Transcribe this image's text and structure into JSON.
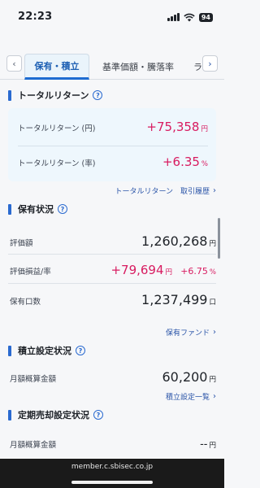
{
  "status": {
    "time": "22:23",
    "battery": "94"
  },
  "tabs": {
    "active": "保有・積立",
    "second": "基準価額・騰落率",
    "third": "ラ"
  },
  "total_return": {
    "title": "トータルリターン",
    "yen_label": "トータルリターン (円)",
    "yen_value": "+75,358",
    "yen_unit": "円",
    "rate_label": "トータルリターン (率)",
    "rate_value": "+6.35",
    "rate_unit": "%",
    "link_label": "トータルリターン　取引履歴"
  },
  "holdings": {
    "title": "保有状況",
    "valuation_label": "評価額",
    "valuation_value": "1,260,268",
    "valuation_unit": "円",
    "gain_label": "評価損益/率",
    "gain_value": "+79,694",
    "gain_unit": "円",
    "gain_rate": "+6.75",
    "gain_rate_unit": "%",
    "units_label": "保有口数",
    "units_value": "1,237,499",
    "units_unit": "口",
    "link_label": "保有ファンド"
  },
  "accumulation": {
    "title": "積立設定状況",
    "monthly_label": "月額概算金額",
    "monthly_value": "60,200",
    "monthly_unit": "円",
    "link_label": "積立設定一覧"
  },
  "periodic_sell": {
    "title": "定期売却設定状況",
    "monthly_label": "月額概算金額",
    "monthly_value": "--",
    "monthly_unit": "円"
  },
  "browser": {
    "url": "member.c.sbisec.co.jp"
  }
}
